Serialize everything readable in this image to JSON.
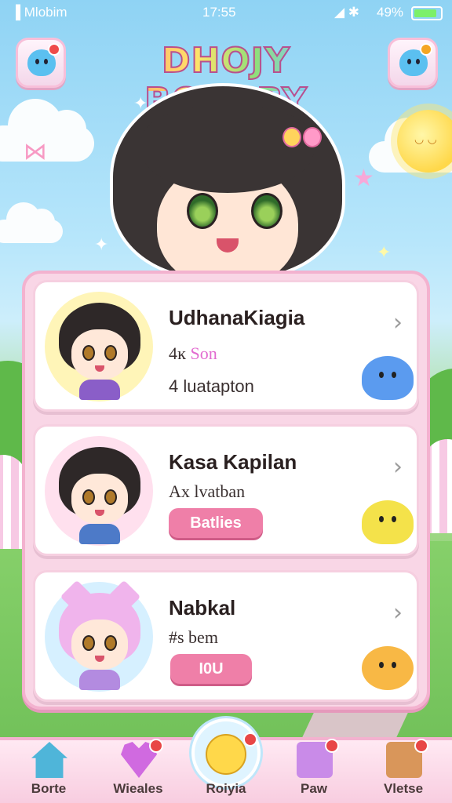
{
  "status_bar": {
    "carrier": "▐ Mlobim",
    "time": "17:55",
    "battery_pct": "49%"
  },
  "header": {
    "logo": "DHOJY BORABY"
  },
  "characters": [
    {
      "name": "UdhanaKiagia",
      "line2_prefix": "4ĸ",
      "line2_highlight": "Son",
      "line3": "4 luatapton",
      "pet": "blue-blob-icon"
    },
    {
      "name": "Kasa Kapilan",
      "line2": "Ax lvatban",
      "pill": "Batlies",
      "pet": "yellow-blob-icon"
    },
    {
      "name": "Nabkal",
      "line2": "#s bem",
      "pill": "I0U",
      "pet": "orange-sun-pet-icon"
    }
  ],
  "nav": [
    {
      "label": "Borte",
      "icon": "home-icon",
      "badge": false
    },
    {
      "label": "Wieales",
      "icon": "heart-icon",
      "badge": true
    },
    {
      "label": "Roiyia",
      "icon": "smiley-icon",
      "badge": true
    },
    {
      "label": "Paw",
      "icon": "gift-icon",
      "badge": true
    },
    {
      "label": "Vletse",
      "icon": "box-icon",
      "badge": true
    }
  ],
  "colors": {
    "accent_pink": "#ef7fa8",
    "panel_pink": "#f9d6e6",
    "sky": "#8fd3f4",
    "grass": "#79c86a"
  }
}
